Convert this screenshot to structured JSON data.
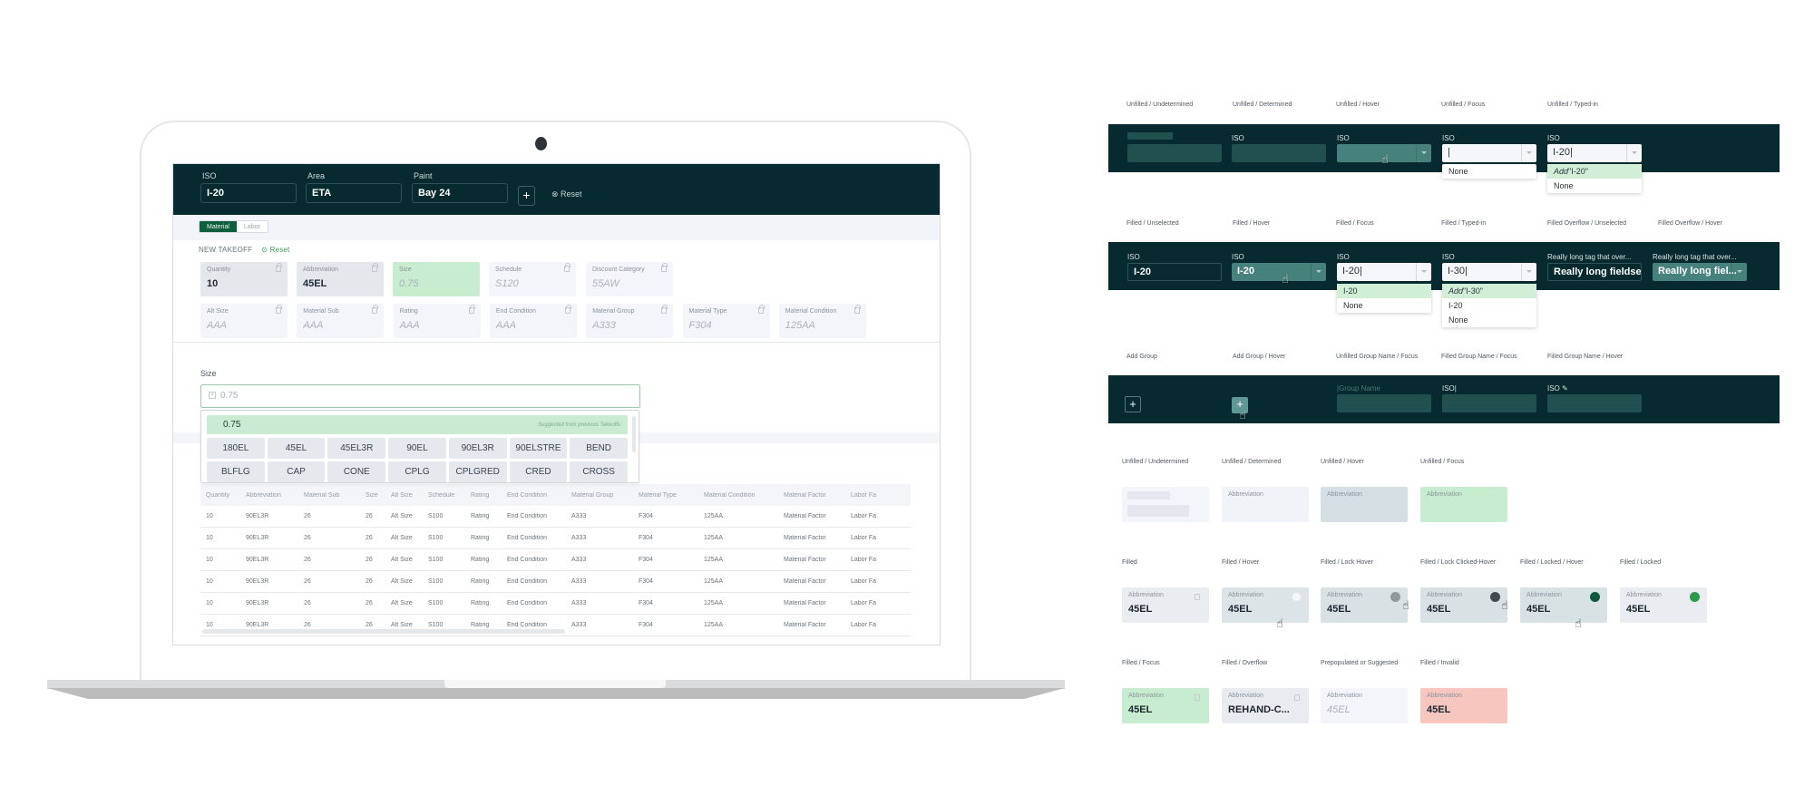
{
  "laptop": {
    "top_bar": {
      "fields": [
        {
          "label": "ISO",
          "value": "I-20"
        },
        {
          "label": "Area",
          "value": "ETA"
        },
        {
          "label": "Paint",
          "value": "Bay 24"
        }
      ],
      "add_label": "+",
      "reset_label": "⊗ Reset"
    },
    "tabs": [
      {
        "label": "Material",
        "active": true
      },
      {
        "label": "Labor",
        "active": false
      }
    ],
    "takeoff": {
      "title": "NEW TAKEOFF",
      "reset_label": "⊙ Reset"
    },
    "cards_row1": [
      {
        "label": "Quantity",
        "value": "10",
        "state": "filled"
      },
      {
        "label": "Abbreviation",
        "value": "45EL",
        "state": "filled"
      },
      {
        "label": "Size",
        "value": "0.75",
        "state": "focus"
      },
      {
        "label": "Schedule",
        "value": "S120",
        "state": "suggested"
      },
      {
        "label": "Discount Category",
        "value": "55AW",
        "state": "suggested"
      }
    ],
    "cards_row2": [
      {
        "label": "Alt Size",
        "value": "AAA"
      },
      {
        "label": "Material Sub",
        "value": "AAA"
      },
      {
        "label": "Rating",
        "value": "AAA"
      },
      {
        "label": "End Condition",
        "value": "AAA"
      },
      {
        "label": "Material Group",
        "value": "A333"
      },
      {
        "label": "Material Type",
        "value": "F304"
      },
      {
        "label": "Material Condition",
        "value": "125AA"
      }
    ],
    "size_picker": {
      "label": "Size",
      "value": "0.75",
      "clear_icon": "×",
      "suggestion": {
        "value": "0.75",
        "note": "Suggested from previous Takeoffs"
      },
      "options": [
        "180EL",
        "45EL",
        "45EL3R",
        "90EL",
        "90EL3R",
        "90ELSTRE",
        "BEND",
        "BLFLG",
        "CAP",
        "CONE",
        "CPLG",
        "CPLGRED",
        "CRED",
        "CROSS"
      ]
    },
    "table": {
      "columns": [
        "Quantity",
        "Abbreviation",
        "Material Sub",
        "Size",
        "Alt Size",
        "Schedule",
        "Rating",
        "End Condition",
        "Material Group",
        "Material Type",
        "Material Condition",
        "Material Factor",
        "Labor Fa"
      ],
      "rows": [
        [
          "10",
          "90EL3R",
          "26",
          "26",
          "Alt Size",
          "S100",
          "Rating",
          "End Condition",
          "A333",
          "F304",
          "125AA",
          "Material Factor",
          "Labor Fa"
        ],
        [
          "10",
          "90EL3R",
          "26",
          "26",
          "Alt Size",
          "S100",
          "Rating",
          "End Condition",
          "A333",
          "F304",
          "125AA",
          "Material Factor",
          "Labor Fa"
        ],
        [
          "10",
          "90EL3R",
          "26",
          "26",
          "Alt Size",
          "S100",
          "Rating",
          "End Condition",
          "A333",
          "F304",
          "125AA",
          "Material Factor",
          "Labor Fa"
        ],
        [
          "10",
          "90EL3R",
          "26",
          "26",
          "Alt Size",
          "S100",
          "Rating",
          "End Condition",
          "A333",
          "F304",
          "125AA",
          "Material Factor",
          "Labor Fa"
        ],
        [
          "10",
          "90EL3R",
          "26",
          "26",
          "Alt Size",
          "S100",
          "Rating",
          "End Condition",
          "A333",
          "F304",
          "125AA",
          "Material Factor",
          "Labor Fa"
        ],
        [
          "10",
          "90EL3R",
          "26",
          "26",
          "Alt Size",
          "S100",
          "Rating",
          "End Condition",
          "A333",
          "F304",
          "125AA",
          "Material Factor",
          "Labor Fa"
        ]
      ]
    }
  },
  "states": {
    "header_unfilled": {
      "labels": [
        "Unfilled / Undetermined",
        "Unfilled / Determined",
        "Unfilled / Hover",
        "Unfilled / Focus",
        "Unfilled / Typed-in"
      ],
      "field_label": "ISO",
      "focus_value": "|",
      "typed_value": "I-20|",
      "focus_menu": [
        "None"
      ],
      "typed_menu": {
        "add_word": "Add",
        "add_value": "\"I-20\"",
        "items": [
          "None"
        ]
      }
    },
    "header_filled": {
      "labels": [
        "Filled / Unselected",
        "Filled / Hover",
        "Filled / Focus",
        "Filled / Typed-in",
        "Filled Overflow / Unselected",
        "Filled Overflow / Hover"
      ],
      "field_label": "ISO",
      "value": "I-20",
      "focus_value": "I-20|",
      "typed_value": "I-30|",
      "focus_menu": [
        "I-20",
        "None"
      ],
      "typed_menu": {
        "add_word": "Add",
        "add_value": "\"I-30\"",
        "items": [
          "I-20",
          "None"
        ]
      },
      "overflow_label": "Really long tag that over...",
      "overflow_value_unselected": "Really long fieldse...",
      "overflow_value_hover": "Really long fiel..."
    },
    "group": {
      "labels": [
        "Add Group",
        "Add Group / Hover",
        "Unfilled Group Name / Focus",
        "Filled Group Name / Focus",
        "Filled Group Name / Hover"
      ],
      "plus": "+",
      "placeholder": "|Group Name",
      "focus_value": "ISO|",
      "hover_value": "ISO ✎"
    },
    "card_unfilled": {
      "labels": [
        "Unfilled / Undetermined",
        "Unfilled / Determined",
        "Unfilled / Hover",
        "Unfilled / Focus"
      ],
      "field_label": "Abbreviation"
    },
    "card_filled": {
      "labels": [
        "Filled",
        "Filled / Hover",
        "Filled / Lock Hover",
        "Filled / Lock Clicked-Hover",
        "Filled / Locked / Hover",
        "Filled / Locked"
      ],
      "field_label": "Abbreviation",
      "value": "45EL"
    },
    "card_misc": {
      "labels": [
        "Filled / Focus",
        "Filled / Overflow",
        "Prepopulated or Suggested",
        "Filled / Invalid"
      ],
      "field_label": "Abbreviation",
      "values": [
        "45EL",
        "REHAND-C...",
        "45EL",
        "45EL"
      ]
    },
    "colors": {
      "dark": "#062a30",
      "focus_green": "#c8ecd0",
      "invalid": "#f6c6bf",
      "locked_green": "#1a8a3c",
      "locked_dark_green": "#0b5a3e"
    }
  }
}
